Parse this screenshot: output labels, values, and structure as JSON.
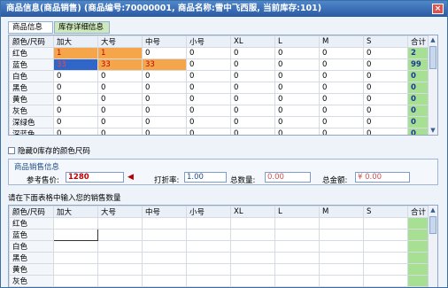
{
  "window": {
    "title": "商品信息(商品销售) (商品编号:70000001, 商品名称:雪中飞西服, 当前库存:101)",
    "close_label": "×"
  },
  "tabs": [
    {
      "label": "商品信息"
    },
    {
      "label": "库存详细信息"
    }
  ],
  "stock_grid": {
    "headers": [
      "颜色/尺码",
      "加大",
      "大号",
      "中号",
      "小号",
      "XL",
      "L",
      "M",
      "S",
      "合计"
    ],
    "rows": [
      {
        "color": "红色",
        "values": [
          "1",
          "1",
          "0",
          "0",
          "0",
          "0",
          "0",
          "0"
        ],
        "total": "2"
      },
      {
        "color": "蓝色",
        "values": [
          "33",
          "33",
          "33",
          "0",
          "0",
          "0",
          "0",
          "0"
        ],
        "total": "99"
      },
      {
        "color": "白色",
        "values": [
          "0",
          "0",
          "0",
          "0",
          "0",
          "0",
          "0",
          "0"
        ],
        "total": "0"
      },
      {
        "color": "黑色",
        "values": [
          "0",
          "0",
          "0",
          "0",
          "0",
          "0",
          "0",
          "0"
        ],
        "total": "0"
      },
      {
        "color": "黄色",
        "values": [
          "0",
          "0",
          "0",
          "0",
          "0",
          "0",
          "0",
          "0"
        ],
        "total": "0"
      },
      {
        "color": "灰色",
        "values": [
          "0",
          "0",
          "0",
          "0",
          "0",
          "0",
          "0",
          "0"
        ],
        "total": "0"
      },
      {
        "color": "深绿色",
        "values": [
          "0",
          "0",
          "0",
          "0",
          "0",
          "0",
          "0",
          "0"
        ],
        "total": "0"
      },
      {
        "color": "深蓝色",
        "values": [
          "0",
          "0",
          "0",
          "0",
          "0",
          "0",
          "0",
          "0"
        ],
        "total": "0"
      }
    ]
  },
  "hide_zero": {
    "label": "隐藏0库存的颜色尺码"
  },
  "sales": {
    "title": "商品销售信息",
    "price_label": "参考售价:",
    "price_value": "1280",
    "discount_label": "打折率:",
    "discount_value": "1.00",
    "qty_label": "总数量:",
    "qty_value": "0.00",
    "amount_label": "总金额:",
    "amount_value": "¥ 0.00"
  },
  "sales_prompt": "请在下面表格中输入您的销售数量",
  "sales_grid": {
    "headers": [
      "颜色/尺码",
      "加大",
      "大号",
      "中号",
      "小号",
      "XL",
      "L",
      "M",
      "S",
      "合计"
    ],
    "rows": [
      {
        "color": "红色"
      },
      {
        "color": "蓝色"
      },
      {
        "color": "白色"
      },
      {
        "color": "黑色"
      },
      {
        "color": "黄色"
      },
      {
        "color": "灰色"
      }
    ]
  },
  "colors": {
    "accent": "#2b5aa3",
    "total_green": "#a7df93",
    "highlight_orange": "#f5a64b",
    "highlight_blue": "#2f66c8"
  },
  "icons": [
    "close-icon",
    "scroll-up-icon",
    "scroll-down-icon",
    "arrow-left-icon"
  ]
}
